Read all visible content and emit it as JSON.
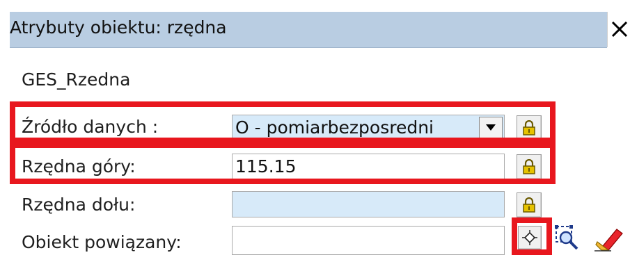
{
  "dialog": {
    "title": "Atrybuty obiektu:  rzędna",
    "object_class": "GES_Rzedna"
  },
  "fields": {
    "source": {
      "label": "Źródło  danych :",
      "value": "O - pomiarbezposredni"
    },
    "top_ordinate": {
      "label": "Rzędna góry:",
      "value": "115.15"
    },
    "bottom_ordinate": {
      "label": "Rzędna dołu:",
      "value": ""
    },
    "linked_object": {
      "label": "Obiekt powiązany:",
      "value": ""
    }
  },
  "icons": {
    "close": "close-icon",
    "dropdown": "chevron-down-icon",
    "lock": "lock-icon",
    "pick_object": "crosshair-icon",
    "search_object": "magnifier-icon",
    "clear": "eraser-icon"
  },
  "colors": {
    "titlebar": "#b9cde2",
    "field_editable": "#d7eaf9",
    "highlight": "#e8171e",
    "lock": "#e6c200"
  }
}
